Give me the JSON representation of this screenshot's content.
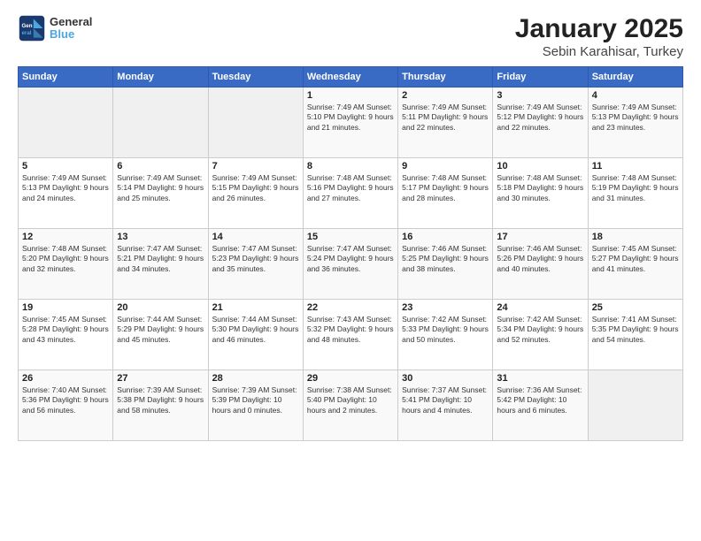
{
  "header": {
    "logo_line1": "General",
    "logo_line2": "Blue",
    "title": "January 2025",
    "subtitle": "Sebin Karahisar, Turkey"
  },
  "weekdays": [
    "Sunday",
    "Monday",
    "Tuesday",
    "Wednesday",
    "Thursday",
    "Friday",
    "Saturday"
  ],
  "weeks": [
    [
      {
        "day": "",
        "info": ""
      },
      {
        "day": "",
        "info": ""
      },
      {
        "day": "",
        "info": ""
      },
      {
        "day": "1",
        "info": "Sunrise: 7:49 AM\nSunset: 5:10 PM\nDaylight: 9 hours and 21 minutes."
      },
      {
        "day": "2",
        "info": "Sunrise: 7:49 AM\nSunset: 5:11 PM\nDaylight: 9 hours and 22 minutes."
      },
      {
        "day": "3",
        "info": "Sunrise: 7:49 AM\nSunset: 5:12 PM\nDaylight: 9 hours and 22 minutes."
      },
      {
        "day": "4",
        "info": "Sunrise: 7:49 AM\nSunset: 5:13 PM\nDaylight: 9 hours and 23 minutes."
      }
    ],
    [
      {
        "day": "5",
        "info": "Sunrise: 7:49 AM\nSunset: 5:13 PM\nDaylight: 9 hours and 24 minutes."
      },
      {
        "day": "6",
        "info": "Sunrise: 7:49 AM\nSunset: 5:14 PM\nDaylight: 9 hours and 25 minutes."
      },
      {
        "day": "7",
        "info": "Sunrise: 7:49 AM\nSunset: 5:15 PM\nDaylight: 9 hours and 26 minutes."
      },
      {
        "day": "8",
        "info": "Sunrise: 7:48 AM\nSunset: 5:16 PM\nDaylight: 9 hours and 27 minutes."
      },
      {
        "day": "9",
        "info": "Sunrise: 7:48 AM\nSunset: 5:17 PM\nDaylight: 9 hours and 28 minutes."
      },
      {
        "day": "10",
        "info": "Sunrise: 7:48 AM\nSunset: 5:18 PM\nDaylight: 9 hours and 30 minutes."
      },
      {
        "day": "11",
        "info": "Sunrise: 7:48 AM\nSunset: 5:19 PM\nDaylight: 9 hours and 31 minutes."
      }
    ],
    [
      {
        "day": "12",
        "info": "Sunrise: 7:48 AM\nSunset: 5:20 PM\nDaylight: 9 hours and 32 minutes."
      },
      {
        "day": "13",
        "info": "Sunrise: 7:47 AM\nSunset: 5:21 PM\nDaylight: 9 hours and 34 minutes."
      },
      {
        "day": "14",
        "info": "Sunrise: 7:47 AM\nSunset: 5:23 PM\nDaylight: 9 hours and 35 minutes."
      },
      {
        "day": "15",
        "info": "Sunrise: 7:47 AM\nSunset: 5:24 PM\nDaylight: 9 hours and 36 minutes."
      },
      {
        "day": "16",
        "info": "Sunrise: 7:46 AM\nSunset: 5:25 PM\nDaylight: 9 hours and 38 minutes."
      },
      {
        "day": "17",
        "info": "Sunrise: 7:46 AM\nSunset: 5:26 PM\nDaylight: 9 hours and 40 minutes."
      },
      {
        "day": "18",
        "info": "Sunrise: 7:45 AM\nSunset: 5:27 PM\nDaylight: 9 hours and 41 minutes."
      }
    ],
    [
      {
        "day": "19",
        "info": "Sunrise: 7:45 AM\nSunset: 5:28 PM\nDaylight: 9 hours and 43 minutes."
      },
      {
        "day": "20",
        "info": "Sunrise: 7:44 AM\nSunset: 5:29 PM\nDaylight: 9 hours and 45 minutes."
      },
      {
        "day": "21",
        "info": "Sunrise: 7:44 AM\nSunset: 5:30 PM\nDaylight: 9 hours and 46 minutes."
      },
      {
        "day": "22",
        "info": "Sunrise: 7:43 AM\nSunset: 5:32 PM\nDaylight: 9 hours and 48 minutes."
      },
      {
        "day": "23",
        "info": "Sunrise: 7:42 AM\nSunset: 5:33 PM\nDaylight: 9 hours and 50 minutes."
      },
      {
        "day": "24",
        "info": "Sunrise: 7:42 AM\nSunset: 5:34 PM\nDaylight: 9 hours and 52 minutes."
      },
      {
        "day": "25",
        "info": "Sunrise: 7:41 AM\nSunset: 5:35 PM\nDaylight: 9 hours and 54 minutes."
      }
    ],
    [
      {
        "day": "26",
        "info": "Sunrise: 7:40 AM\nSunset: 5:36 PM\nDaylight: 9 hours and 56 minutes."
      },
      {
        "day": "27",
        "info": "Sunrise: 7:39 AM\nSunset: 5:38 PM\nDaylight: 9 hours and 58 minutes."
      },
      {
        "day": "28",
        "info": "Sunrise: 7:39 AM\nSunset: 5:39 PM\nDaylight: 10 hours and 0 minutes."
      },
      {
        "day": "29",
        "info": "Sunrise: 7:38 AM\nSunset: 5:40 PM\nDaylight: 10 hours and 2 minutes."
      },
      {
        "day": "30",
        "info": "Sunrise: 7:37 AM\nSunset: 5:41 PM\nDaylight: 10 hours and 4 minutes."
      },
      {
        "day": "31",
        "info": "Sunrise: 7:36 AM\nSunset: 5:42 PM\nDaylight: 10 hours and 6 minutes."
      },
      {
        "day": "",
        "info": ""
      }
    ]
  ]
}
